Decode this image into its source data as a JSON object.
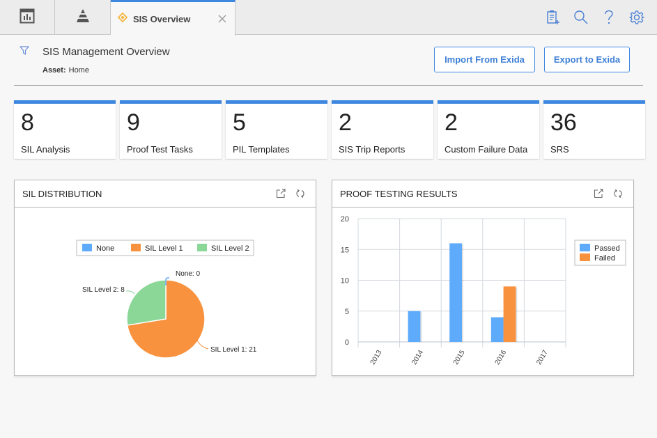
{
  "topbar": {
    "nav_tabs": [
      {
        "icon": "dashboard-icon"
      },
      {
        "icon": "pyramid-icon"
      }
    ],
    "active_tab": {
      "title": "SIS Overview",
      "icon": "diamond-icon",
      "close_icon": "close-icon"
    },
    "tools": [
      {
        "icon": "new-document-icon"
      },
      {
        "icon": "search-icon"
      },
      {
        "icon": "help-icon"
      },
      {
        "icon": "gear-icon"
      }
    ]
  },
  "header": {
    "title": "SIS Management Overview",
    "asset_label": "Asset:",
    "asset_value": "Home",
    "import_button": "Import From Exida",
    "export_button": "Export to Exida"
  },
  "tiles": [
    {
      "count": "8",
      "label": "SIL Analysis"
    },
    {
      "count": "9",
      "label": "Proof Test Tasks"
    },
    {
      "count": "5",
      "label": "PIL Templates"
    },
    {
      "count": "2",
      "label": "SIS Trip Reports"
    },
    {
      "count": "2",
      "label": "Custom Failure Data"
    },
    {
      "count": "36",
      "label": "SRS"
    }
  ],
  "colors": {
    "accent": "#3e87e0",
    "none": "#5fabfb",
    "sil1": "#f8923e",
    "sil2": "#8ad797",
    "passed": "#5fabfb",
    "failed": "#f8923e",
    "grid": "#d3d8de"
  },
  "panels": {
    "sil_distribution": {
      "title": "SIL DISTRIBUTION"
    },
    "proof_testing": {
      "title": "PROOF TESTING RESULTS"
    }
  },
  "chart_data": [
    {
      "type": "pie",
      "title": "SIL DISTRIBUTION",
      "legend": [
        "None",
        "SIL Level 1",
        "SIL Level 2"
      ],
      "legend_position": "top",
      "slices": [
        {
          "label": "None",
          "value": 0,
          "data_label": "None: 0"
        },
        {
          "label": "SIL Level 1",
          "value": 21,
          "data_label": "SIL Level 1: 21"
        },
        {
          "label": "SIL Level 2",
          "value": 8,
          "data_label": "SIL Level 2: 8"
        }
      ]
    },
    {
      "type": "bar",
      "title": "PROOF TESTING RESULTS",
      "categories": [
        "2013",
        "2014",
        "2015",
        "2016",
        "2017"
      ],
      "series": [
        {
          "name": "Passed",
          "values": [
            0,
            5,
            16,
            4,
            0
          ]
        },
        {
          "name": "Failed",
          "values": [
            0,
            0,
            0,
            9,
            0
          ]
        }
      ],
      "ylim": [
        0,
        20
      ],
      "yticks": [
        "0",
        "5",
        "10",
        "15",
        "20"
      ],
      "grid": true,
      "legend_position": "right",
      "xlabel": "",
      "ylabel": ""
    }
  ]
}
